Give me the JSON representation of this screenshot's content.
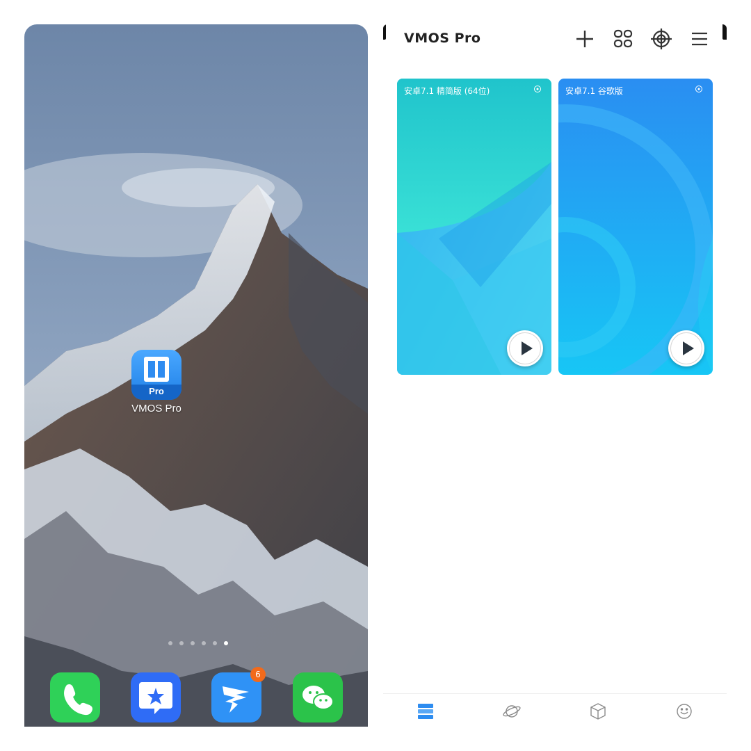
{
  "home_screen": {
    "app_icon": {
      "label": "VMOS Pro",
      "badge_text": "Pro"
    },
    "page_indicator": {
      "total": 6,
      "current": 6
    },
    "dock": [
      {
        "name": "phone-icon",
        "color": "#2fd158"
      },
      {
        "name": "dingtalk-star-icon",
        "color": "#2f6cf6"
      },
      {
        "name": "messenger-bird-icon",
        "color": "#2f92f6",
        "badge": "6"
      },
      {
        "name": "wechat-icon",
        "color": "#2bc34a"
      }
    ]
  },
  "vmos_app": {
    "title": "VMOS Pro",
    "toolbar": [
      {
        "name": "add-icon"
      },
      {
        "name": "grid-icon"
      },
      {
        "name": "target-icon"
      },
      {
        "name": "menu-icon"
      }
    ],
    "vms": [
      {
        "title": "安卓7.1 精简版 (64位)",
        "colors": [
          "#22c8cf",
          "#3fd3ee"
        ]
      },
      {
        "title": "安卓7.1 谷歌版",
        "colors": [
          "#2a8ef2",
          "#1fc6f4"
        ]
      }
    ],
    "tabs": [
      {
        "label": "",
        "icon": "server-icon",
        "active": true
      },
      {
        "label": "",
        "icon": "planet-icon",
        "active": false
      },
      {
        "label": "",
        "icon": "cube-icon",
        "active": false
      },
      {
        "label": "",
        "icon": "smile-icon",
        "active": false
      }
    ]
  }
}
